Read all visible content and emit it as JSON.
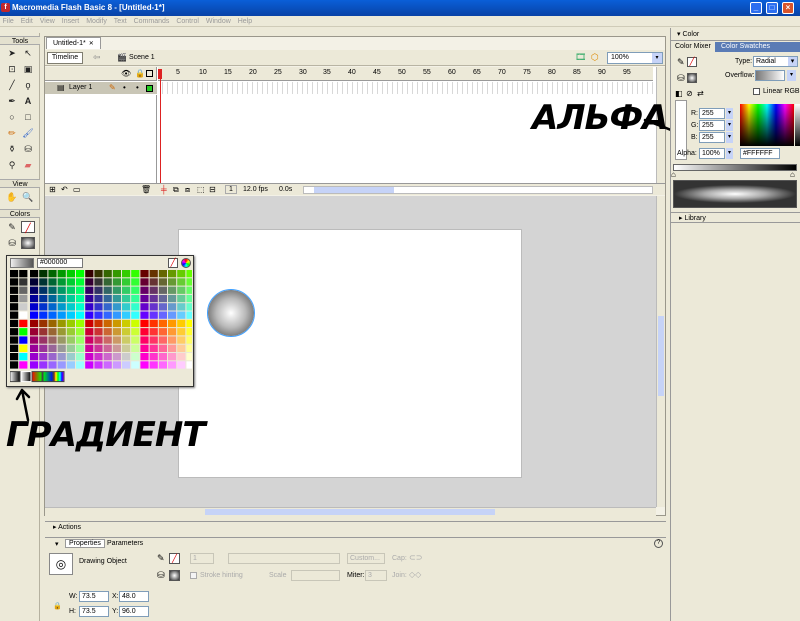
{
  "window": {
    "title": "Macromedia Flash Basic 8 - [Untitled-1*]",
    "min": "_",
    "max": "□",
    "close": "×"
  },
  "menu": [
    "File",
    "Edit",
    "View",
    "Insert",
    "Modify",
    "Text",
    "Commands",
    "Control",
    "Window",
    "Help"
  ],
  "tools": {
    "title": "Tools",
    "view": "View",
    "colors": "Colors"
  },
  "document": {
    "tab": "Untitled-1*",
    "timeline_button": "Timeline",
    "scene": "Scene 1",
    "zoom": "100%",
    "layer_name": "Layer 1",
    "ruler": [
      "5",
      "10",
      "15",
      "20",
      "25",
      "30",
      "35",
      "40",
      "45",
      "50",
      "55",
      "60",
      "65",
      "70",
      "75",
      "80",
      "85",
      "90",
      "95"
    ],
    "frame": "1",
    "fps": "12.0 fps",
    "time": "0.0s"
  },
  "swatch": {
    "hex": "#000000"
  },
  "annotations": {
    "gradient": "ГРАДИЕНТ",
    "alpha": "АЛЬФА"
  },
  "color_panel": {
    "title": "Color",
    "tab_mixer": "Color Mixer",
    "tab_swatches": "Color Swatches",
    "type_label": "Type:",
    "type_value": "Radial",
    "overflow_label": "Overflow:",
    "linear_rgb": "Linear RGB",
    "r_label": "R:",
    "r": "255",
    "g_label": "G:",
    "g": "255",
    "b_label": "B:",
    "b": "255",
    "alpha_label": "Alpha:",
    "alpha": "100%",
    "hex": "#FFFFFF",
    "library": "Library"
  },
  "properties": {
    "actions": "Actions",
    "tab_props": "Properties",
    "tab_params": "Parameters",
    "object": "Drawing Object",
    "stroke_height": "1",
    "custom": "Custom...",
    "cap": "Cap:",
    "stroke_hinting": "Stroke hinting",
    "scale": "Scale",
    "miter": "Miter:",
    "miter_value": "3",
    "join": "Join:",
    "w_label": "W:",
    "w": "73.5",
    "h_label": "H:",
    "h": "73.5",
    "x_label": "X:",
    "x": "48.0",
    "y_label": "Y:",
    "y": "96.0"
  },
  "colors": {
    "accent_title": "#0842a6",
    "stage_bg": "#d4d4d4",
    "playhead": "#dd2222"
  }
}
